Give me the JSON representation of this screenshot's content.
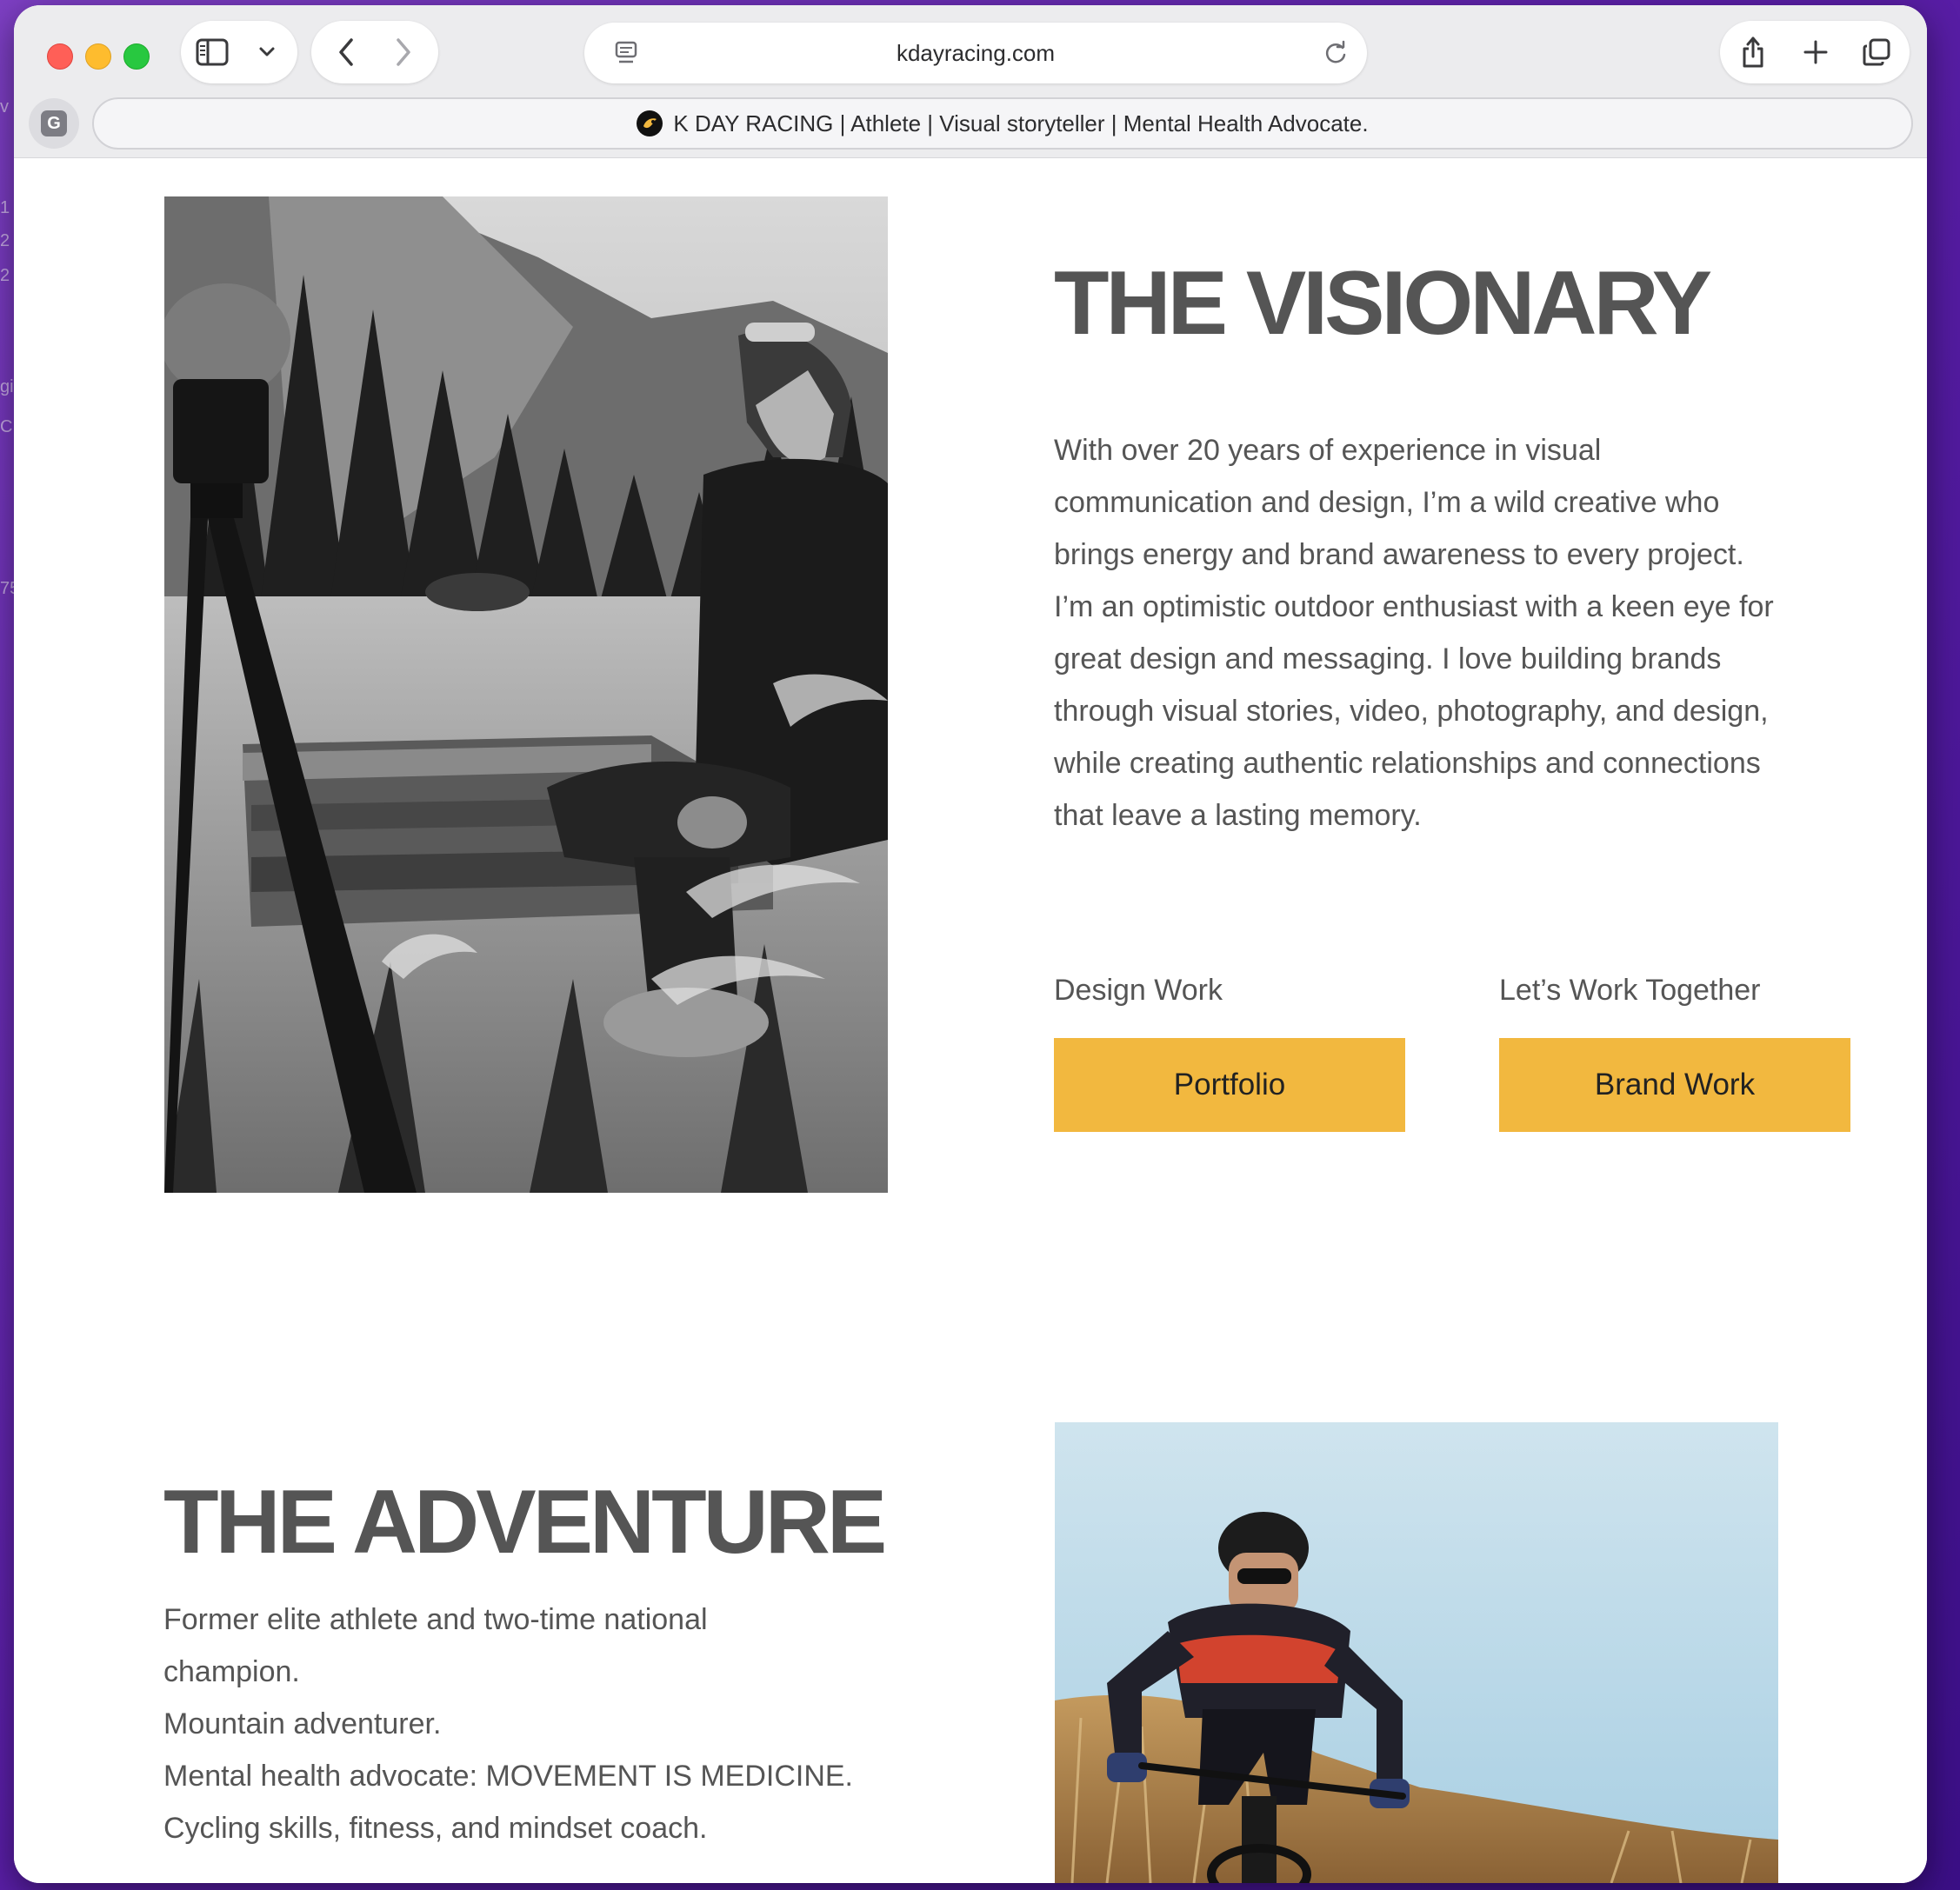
{
  "desktop": {
    "edge_fragments": [
      "v",
      "1",
      "2",
      "2",
      "gi",
      "C",
      "75"
    ]
  },
  "browser": {
    "url": "kdayracing.com",
    "tab_title": "K DAY RACING | Athlete | Visual storyteller | Mental Health Advocate.",
    "profile_badge": "G"
  },
  "visionary": {
    "title": "THE VISIONARY",
    "body": "With over 20 years of experience in visual communication and design, I’m a wild creative who brings energy and brand awareness to every project. I’m an optimistic outdoor enthusiast with a keen eye for great design and messaging. I love building brands through visual stories, video, photography, and design, while creating authentic relationships and connections that leave a lasting memory.",
    "photo_alt": "Black and white photo of man in beanie sitting on wooden bridge in forest valley beside a camera on tripod",
    "cta": [
      {
        "label": "Design Work",
        "button": "Portfolio"
      },
      {
        "label": "Let’s Work Together",
        "button": "Brand Work"
      }
    ]
  },
  "adventure": {
    "title": "THE ADVENTURE",
    "lines": [
      "Former elite athlete and two-time national",
      "champion.",
      "Mountain adventurer.",
      "Mental health advocate: MOVEMENT IS MEDICINE.",
      "Cycling skills, fitness, and mindset coach."
    ],
    "photo_alt": "Mountain biker in helmet and sunglasses riding through dry grass under a blue sky"
  },
  "colors": {
    "accent": "#f2b83f",
    "heading": "#555555",
    "text": "#555555"
  }
}
